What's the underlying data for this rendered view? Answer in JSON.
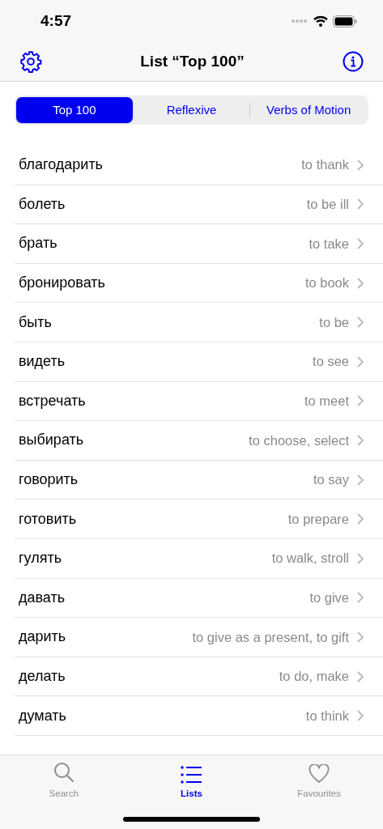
{
  "status_bar": {
    "time": "4:57"
  },
  "nav": {
    "title": "List “Top 100”"
  },
  "segments": [
    {
      "label": "Top 100",
      "selected": true
    },
    {
      "label": "Reflexive",
      "selected": false
    },
    {
      "label": "Verbs of Motion",
      "selected": false
    }
  ],
  "rows": [
    {
      "word": "благодарить",
      "translation": "to thank"
    },
    {
      "word": "болеть",
      "translation": "to be ill"
    },
    {
      "word": "брать",
      "translation": "to take"
    },
    {
      "word": "бронировать",
      "translation": "to book"
    },
    {
      "word": "быть",
      "translation": "to be"
    },
    {
      "word": "видеть",
      "translation": "to see"
    },
    {
      "word": "встречать",
      "translation": "to meet"
    },
    {
      "word": "выбирать",
      "translation": "to choose, select"
    },
    {
      "word": "говорить",
      "translation": "to say"
    },
    {
      "word": "готовить",
      "translation": "to prepare"
    },
    {
      "word": "гулять",
      "translation": "to walk, stroll"
    },
    {
      "word": "давать",
      "translation": "to give"
    },
    {
      "word": "дарить",
      "translation": "to give as a present, to gift"
    },
    {
      "word": "делать",
      "translation": "to do, make"
    },
    {
      "word": "думать",
      "translation": "to think"
    }
  ],
  "tab_bar": [
    {
      "label": "Search",
      "kind": "search",
      "selected": false
    },
    {
      "label": "Lists",
      "kind": "lists",
      "selected": true
    },
    {
      "label": "Favourites",
      "kind": "heart",
      "selected": false
    }
  ]
}
